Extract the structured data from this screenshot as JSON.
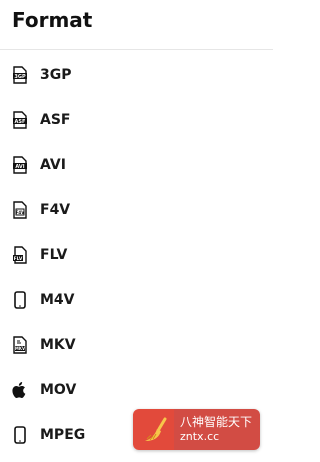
{
  "header": {
    "title": "Format"
  },
  "formats": [
    {
      "label": "3GP",
      "icon": "file-3gp-icon"
    },
    {
      "label": "ASF",
      "icon": "file-asf-icon"
    },
    {
      "label": "AVI",
      "icon": "file-avi-icon"
    },
    {
      "label": "F4V",
      "icon": "file-f4v-icon"
    },
    {
      "label": "FLV",
      "icon": "file-flv-icon"
    },
    {
      "label": "M4V",
      "icon": "phone-icon"
    },
    {
      "label": "MKV",
      "icon": "file-mkv-icon"
    },
    {
      "label": "MOV",
      "icon": "apple-icon"
    },
    {
      "label": "MPEG",
      "icon": "phone-icon"
    }
  ],
  "watermark": {
    "line1": "八神智能天下",
    "line2": "zntx.cc",
    "colors": {
      "logo_bg": "#e24a3b",
      "text_bg": "#d24c44"
    }
  }
}
